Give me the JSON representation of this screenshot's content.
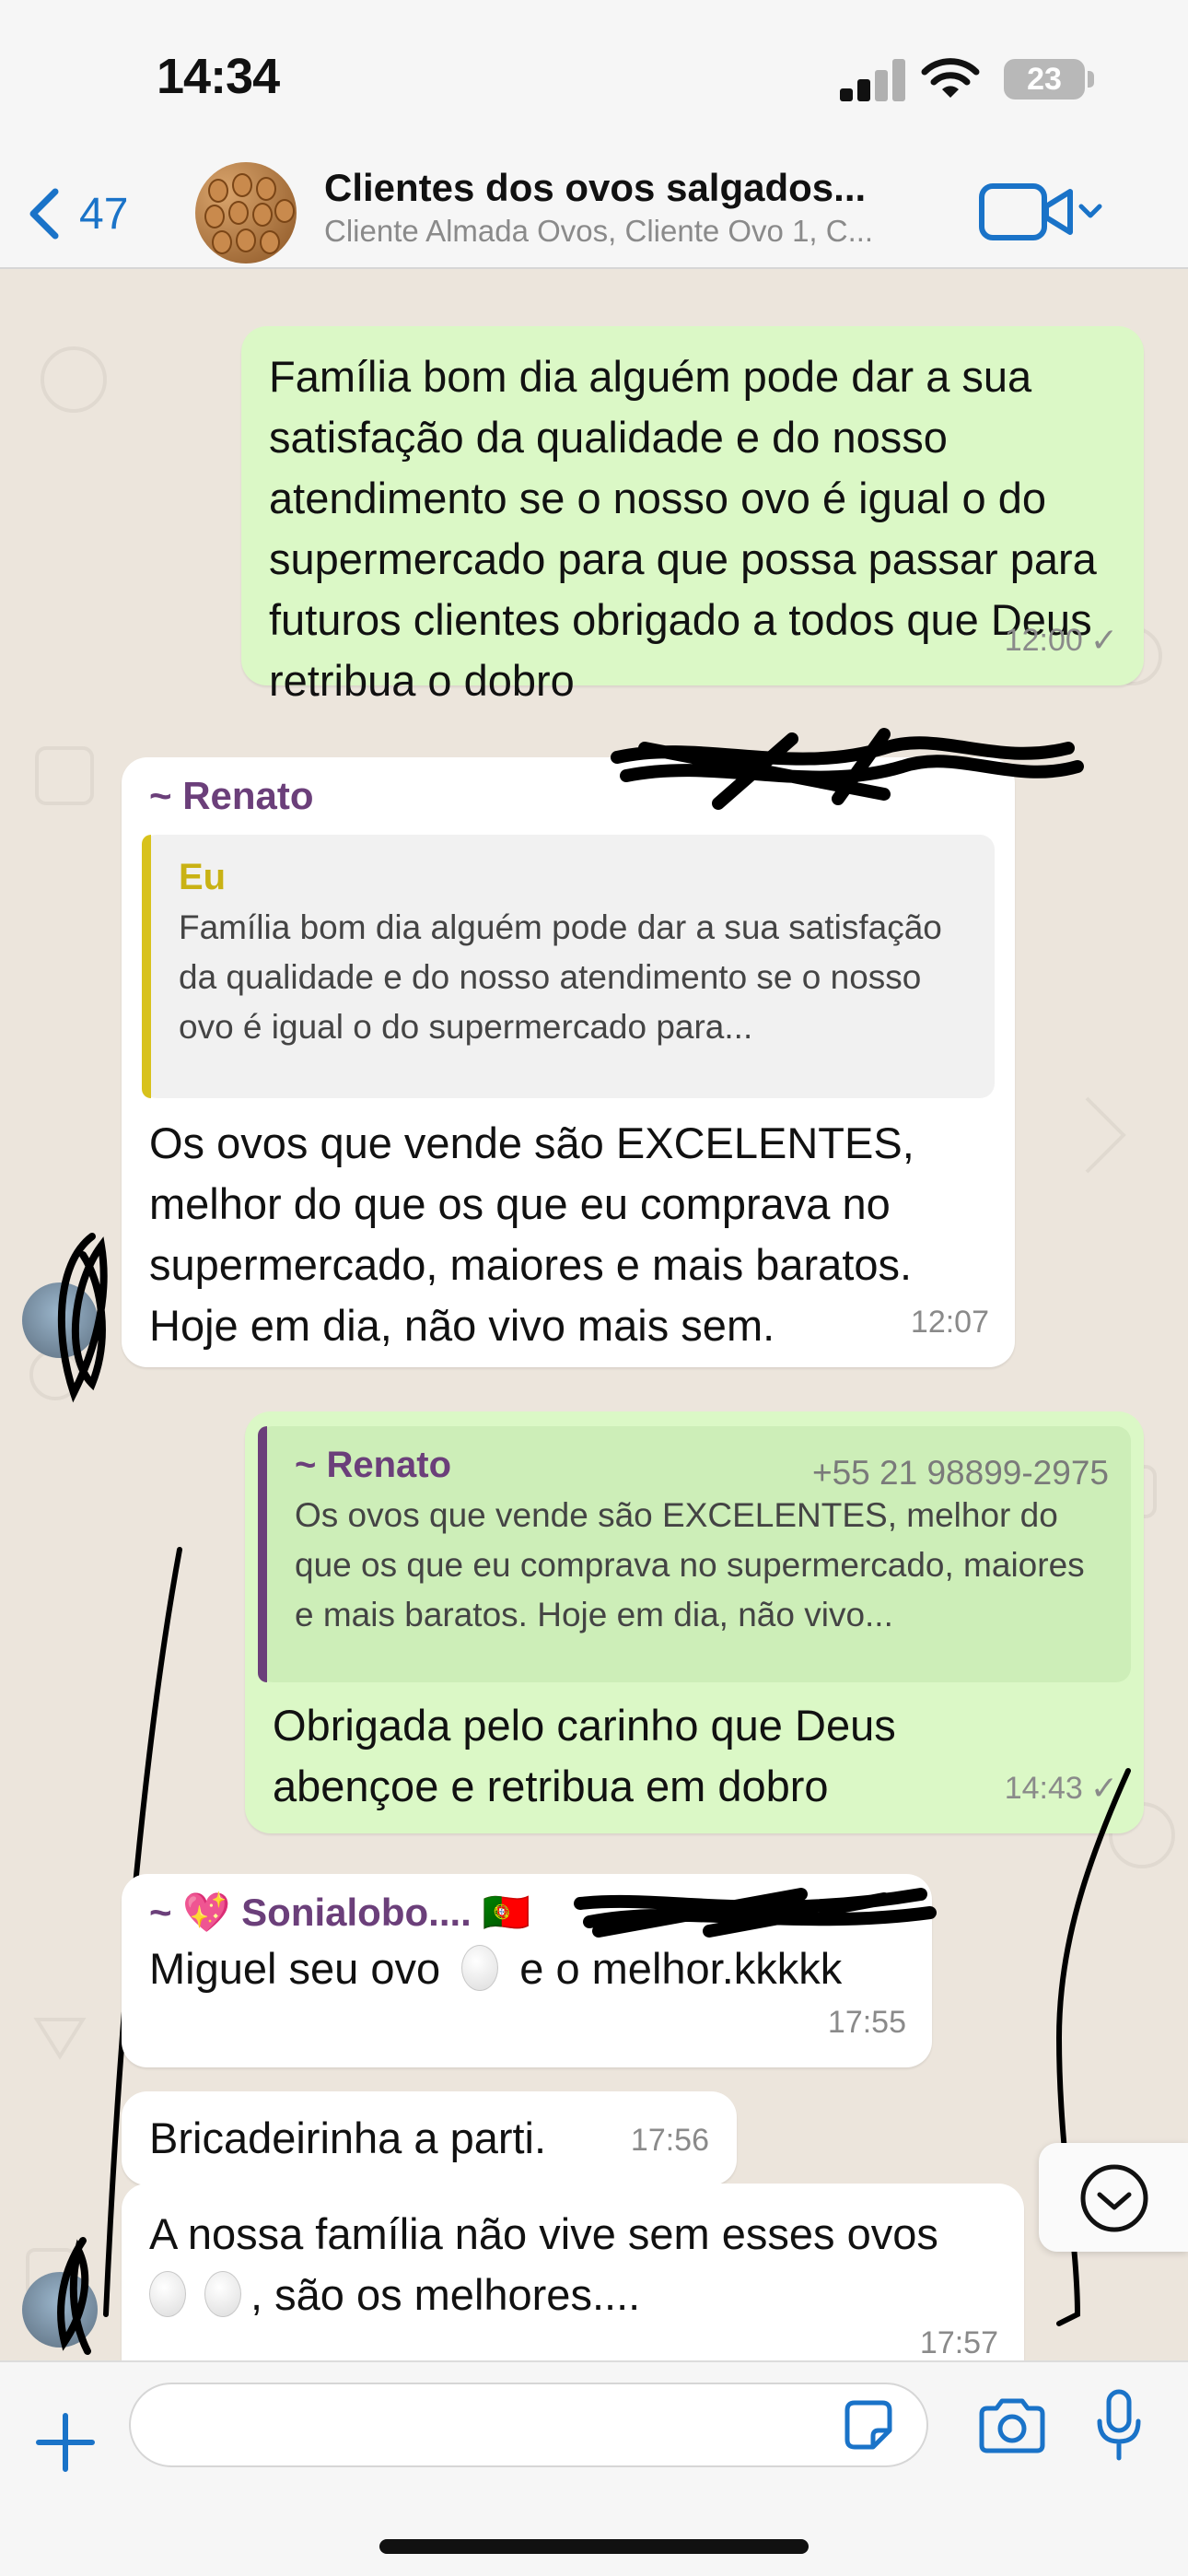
{
  "status_bar": {
    "time": "14:34",
    "battery": "23"
  },
  "header": {
    "back_count": "47",
    "title": "Clientes dos ovos salgados...",
    "subtitle": "Cliente Almada Ovos, Cliente Ovo 1, C..."
  },
  "messages": [
    {
      "direction": "outgoing",
      "text": "Família bom dia alguém pode dar a sua satisfação da qualidade e do nosso atendimento se o nosso ovo é igual o do supermercado para que possa passar para futuros clientes obrigado a todos que Deus retribua o dobro",
      "time": "12:00",
      "status": "✓"
    },
    {
      "direction": "incoming",
      "sender": "~ Renato",
      "quote_author": "Eu",
      "quote_text": "Família bom dia alguém pode dar a sua satisfação da qualidade e do nosso atendimento se o nosso ovo é igual o do supermercado para...",
      "text": "Os ovos que vende são EXCELENTES, melhor do que os que eu comprava no supermercado, maiores e mais baratos. Hoje em dia, não vivo mais sem.",
      "time": "12:07"
    },
    {
      "direction": "outgoing",
      "quote_author": "~ Renato",
      "quote_phone": "+55 21 98899-2975",
      "quote_text": "Os ovos que vende são EXCELENTES, melhor do que os que eu comprava no supermercado, maiores e mais baratos. Hoje em dia, não vivo...",
      "text": "Obrigada pelo carinho que Deus abençoe e retribua em dobro",
      "time": "14:43",
      "status": "✓"
    },
    {
      "direction": "incoming",
      "sender": "~ 💖 Sonialobo.... 🇵🇹",
      "text_before": "Miguel seu ovo",
      "text_after": "e o melhor.kkkkk",
      "time": "17:55"
    },
    {
      "direction": "incoming",
      "text": "Bricadeirinha a parti.",
      "time": "17:56"
    },
    {
      "direction": "incoming",
      "text_line1": "A nossa família não vive sem esses ovos",
      "text_after": ", são os melhores....",
      "time": "17:57"
    }
  ],
  "input": {
    "placeholder": ""
  },
  "icons": {
    "back": "chevron-left-icon",
    "video": "video-call-icon",
    "plus": "plus-icon",
    "sticker": "sticker-icon",
    "camera": "camera-icon",
    "mic": "microphone-icon",
    "scroll": "scroll-down-icon"
  },
  "colors": {
    "accent": "#1a73c8",
    "outgoing_bubble": "#dbf8c6",
    "incoming_bubble": "#ffffff",
    "sender_name": "#6b3f7a",
    "quote_bar_self": "#d8c21c"
  }
}
